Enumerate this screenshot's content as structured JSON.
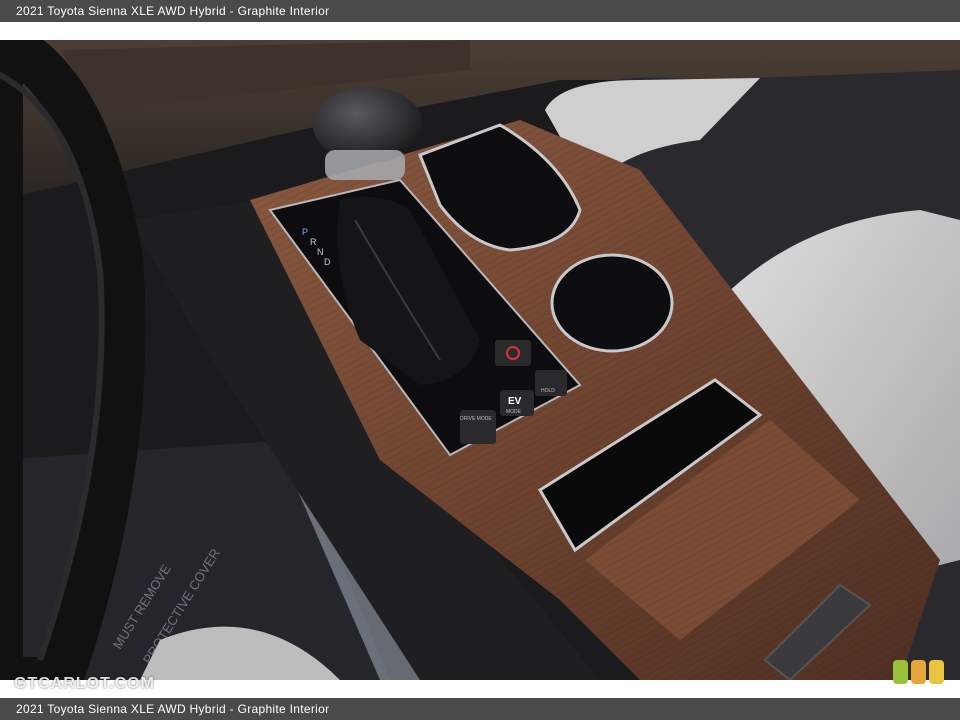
{
  "caption": "2021 Toyota Sienna XLE AWD Hybrid - Graphite Interior",
  "watermark": "GTCARLOT.COM",
  "photo": {
    "subject": "center-console",
    "gear_letters": [
      "P",
      "R",
      "N",
      "D"
    ],
    "buttons": {
      "drive_mode": "DRIVE MODE",
      "ev_mode_big": "EV",
      "ev_mode_small": "MODE",
      "hold": "HOLD"
    },
    "mat_text": [
      "MUST REMOVE",
      "PROTECTIVE COVER"
    ]
  },
  "colors": {
    "caption_bar": "#4a4a4a",
    "wood_trim": "#6e4430",
    "leather_gray": "#c9c9c9",
    "logo_green": "#9ac13b",
    "logo_orange": "#e6a53a",
    "logo_yellow": "#e9c440"
  }
}
